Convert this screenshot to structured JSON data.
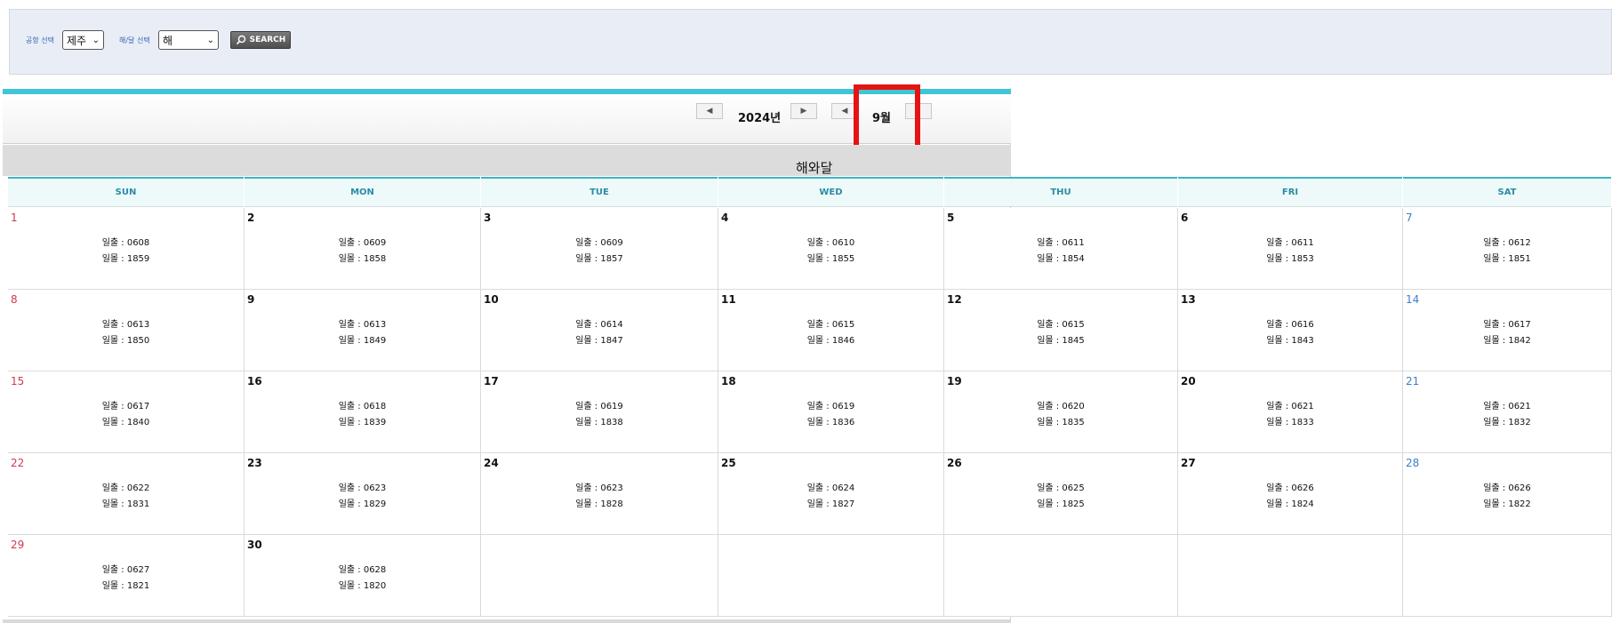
{
  "filter": {
    "airport_label": "공항 선택",
    "airport_value": "제주",
    "sunmoon_label": "해/달 선택",
    "sunmoon_value": "해",
    "search_label": "SEARCH"
  },
  "header": {
    "year": "2024년",
    "month": "9월",
    "title": "해와달"
  },
  "weekdays": [
    "SUN",
    "MON",
    "TUE",
    "WED",
    "THU",
    "FRI",
    "SAT"
  ],
  "weeks": [
    [
      {
        "day": "1",
        "sunrise": "일출 : 0608",
        "sunset": "일몰 : 1859"
      },
      {
        "day": "2",
        "sunrise": "일출 : 0609",
        "sunset": "일몰 : 1858"
      },
      {
        "day": "3",
        "sunrise": "일출 : 0609",
        "sunset": "일몰 : 1857"
      },
      {
        "day": "4",
        "sunrise": "일출 : 0610",
        "sunset": "일몰 : 1855"
      },
      {
        "day": "5",
        "sunrise": "일출 : 0611",
        "sunset": "일몰 : 1854"
      },
      {
        "day": "6",
        "sunrise": "일출 : 0611",
        "sunset": "일몰 : 1853"
      },
      {
        "day": "7",
        "sunrise": "일출 : 0612",
        "sunset": "일몰 : 1851"
      }
    ],
    [
      {
        "day": "8",
        "sunrise": "일출 : 0613",
        "sunset": "일몰 : 1850"
      },
      {
        "day": "9",
        "sunrise": "일출 : 0613",
        "sunset": "일몰 : 1849"
      },
      {
        "day": "10",
        "sunrise": "일출 : 0614",
        "sunset": "일몰 : 1847"
      },
      {
        "day": "11",
        "sunrise": "일출 : 0615",
        "sunset": "일몰 : 1846"
      },
      {
        "day": "12",
        "sunrise": "일출 : 0615",
        "sunset": "일몰 : 1845"
      },
      {
        "day": "13",
        "sunrise": "일출 : 0616",
        "sunset": "일몰 : 1843"
      },
      {
        "day": "14",
        "sunrise": "일출 : 0617",
        "sunset": "일몰 : 1842"
      }
    ],
    [
      {
        "day": "15",
        "sunrise": "일출 : 0617",
        "sunset": "일몰 : 1840"
      },
      {
        "day": "16",
        "sunrise": "일출 : 0618",
        "sunset": "일몰 : 1839"
      },
      {
        "day": "17",
        "sunrise": "일출 : 0619",
        "sunset": "일몰 : 1838"
      },
      {
        "day": "18",
        "sunrise": "일출 : 0619",
        "sunset": "일몰 : 1836"
      },
      {
        "day": "19",
        "sunrise": "일출 : 0620",
        "sunset": "일몰 : 1835"
      },
      {
        "day": "20",
        "sunrise": "일출 : 0621",
        "sunset": "일몰 : 1833"
      },
      {
        "day": "21",
        "sunrise": "일출 : 0621",
        "sunset": "일몰 : 1832"
      }
    ],
    [
      {
        "day": "22",
        "sunrise": "일출 : 0622",
        "sunset": "일몰 : 1831"
      },
      {
        "day": "23",
        "sunrise": "일출 : 0623",
        "sunset": "일몰 : 1829"
      },
      {
        "day": "24",
        "sunrise": "일출 : 0623",
        "sunset": "일몰 : 1828"
      },
      {
        "day": "25",
        "sunrise": "일출 : 0624",
        "sunset": "일몰 : 1827"
      },
      {
        "day": "26",
        "sunrise": "일출 : 0625",
        "sunset": "일몰 : 1825"
      },
      {
        "day": "27",
        "sunrise": "일출 : 0626",
        "sunset": "일몰 : 1824"
      },
      {
        "day": "28",
        "sunrise": "일출 : 0626",
        "sunset": "일몰 : 1822"
      }
    ],
    [
      {
        "day": "29",
        "sunrise": "일출 : 0627",
        "sunset": "일몰 : 1821"
      },
      {
        "day": "30",
        "sunrise": "일출 : 0628",
        "sunset": "일몰 : 1820"
      },
      {
        "day": "",
        "sunrise": "",
        "sunset": ""
      },
      {
        "day": "",
        "sunrise": "",
        "sunset": ""
      },
      {
        "day": "",
        "sunrise": "",
        "sunset": ""
      },
      {
        "day": "",
        "sunrise": "",
        "sunset": ""
      },
      {
        "day": "",
        "sunrise": "",
        "sunset": ""
      }
    ]
  ],
  "colors": {
    "accent": "#3fc5d6",
    "weekday_text": "#2a8ca8",
    "sunday": "#d0384f",
    "saturday": "#3a80c8",
    "highlight": "#e41414"
  }
}
